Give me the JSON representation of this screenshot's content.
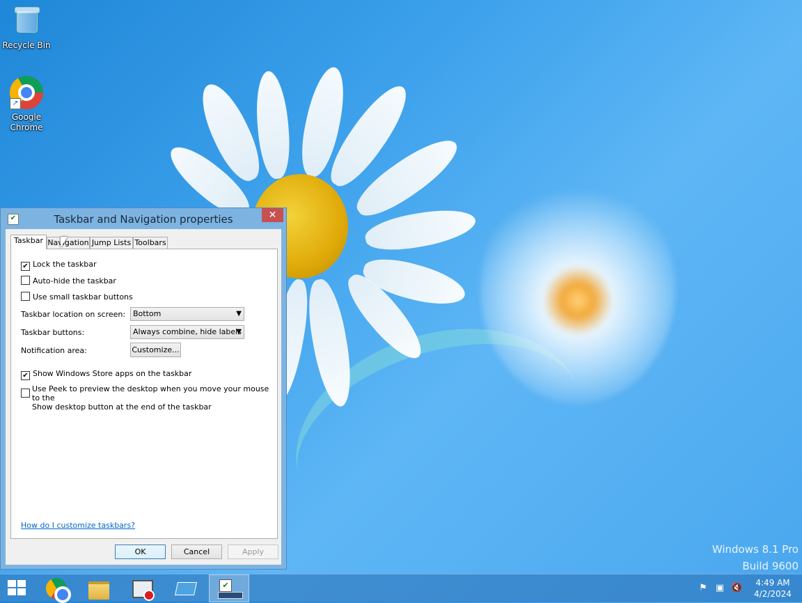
{
  "desktop": {
    "icons": [
      {
        "label_line1": "Recycle Bin"
      },
      {
        "label_line1": "Google",
        "label_line2": "Chrome"
      }
    ],
    "watermark": {
      "line1": "Windows 8.1 Pro",
      "line2": "Build 9600"
    }
  },
  "dialog": {
    "title": "Taskbar and Navigation properties",
    "close_glyph": "✕",
    "tabs": [
      {
        "label": "Taskbar",
        "active": true
      },
      {
        "label": "Navigation",
        "active": false
      },
      {
        "label": "Jump Lists",
        "active": false
      },
      {
        "label": "Toolbars",
        "active": false
      }
    ],
    "taskbar_tab": {
      "lock_taskbar": {
        "label": "Lock the taskbar",
        "checked": true
      },
      "auto_hide": {
        "label": "Auto-hide the taskbar",
        "checked": false
      },
      "small_buttons": {
        "label": "Use small taskbar buttons",
        "checked": false
      },
      "location_label": "Taskbar location on screen:",
      "location_value": "Bottom",
      "buttons_label": "Taskbar buttons:",
      "buttons_value": "Always combine, hide labels",
      "notification_label": "Notification area:",
      "customize_button": "Customize...",
      "store_apps": {
        "label": "Show Windows Store apps on the taskbar",
        "checked": true
      },
      "peek": {
        "label_line1": "Use Peek to preview the desktop when you move your mouse to the",
        "label_line2": "Show desktop button at the end of the taskbar",
        "checked": false
      },
      "help_link": "How do I customize taskbars?"
    },
    "buttons": {
      "ok": "OK",
      "cancel": "Cancel",
      "apply": "Apply"
    }
  },
  "taskbar": {
    "clock_time": "4:49 AM",
    "clock_date": "4/2/2024",
    "tray_icons": [
      "flag-icon",
      "network-icon",
      "volume-muted-icon"
    ]
  },
  "colors": {
    "desktop_bg": "#3ea2ec",
    "close_button": "#c75050",
    "link": "#0066cc"
  }
}
